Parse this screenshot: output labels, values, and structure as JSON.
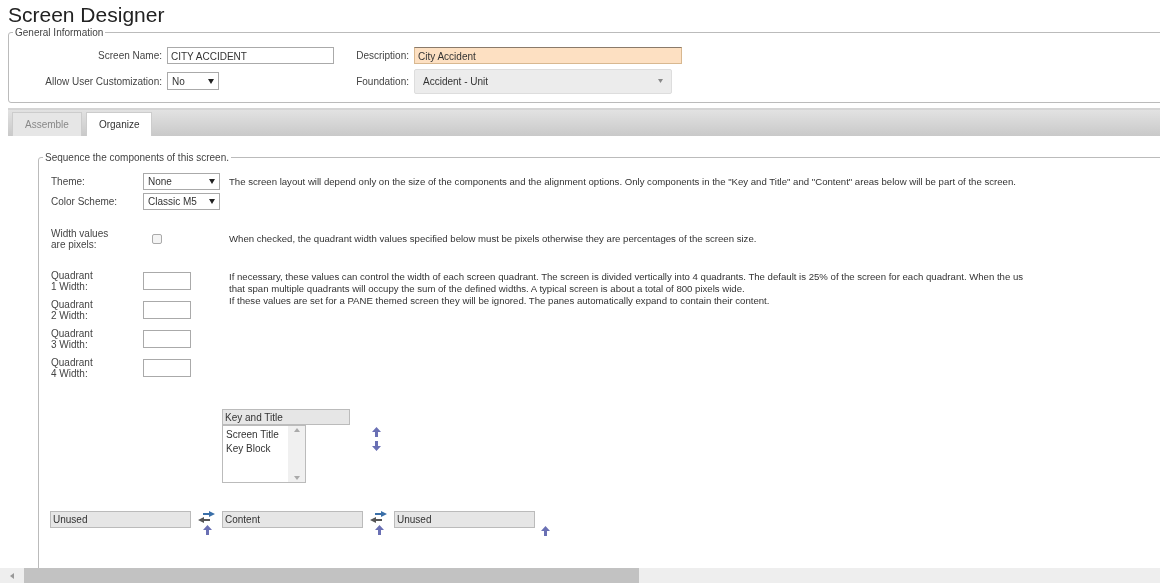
{
  "title": "Screen Designer",
  "general_information": {
    "legend": "General Information",
    "fields": [
      {
        "label": "Screen Name:",
        "kind": "text",
        "value": "CITY ACCIDENT",
        "highlighted": false
      },
      {
        "label": "Description:",
        "kind": "text",
        "value": "City Accident",
        "highlighted": true
      },
      {
        "label": "Allow User Customization:",
        "kind": "select",
        "value": "No"
      },
      {
        "label": "Foundation:",
        "kind": "combo",
        "value": "Accident - Unit"
      }
    ]
  },
  "tabs": [
    {
      "label": "Assemble",
      "selected": false
    },
    {
      "label": "Organize",
      "selected": true
    }
  ],
  "organize": {
    "legend": "Sequence the components of this screen.",
    "theme": {
      "label": "Theme:",
      "value": "None"
    },
    "color_scheme": {
      "label": "Color Scheme:",
      "value": "Classic M5"
    },
    "theme_note": "The screen layout will depend only on the size of the components and the alignment options. Only components in the \"Key and Title\" and \"Content\" areas below will be part of the screen.",
    "width_pixels": {
      "label": "Width values are pixels:",
      "checked": false,
      "note": "When checked, the quadrant width values specified below must be pixels otherwise they are percentages of the screen size."
    },
    "quadrants": [
      {
        "label": "Quadrant 1 Width:"
      },
      {
        "label": "Quadrant 2 Width:"
      },
      {
        "label": "Quadrant 3 Width:"
      },
      {
        "label": "Quadrant 4 Width:"
      }
    ],
    "quadrant_note": [
      "If necessary, these values can control the width of each screen quadrant. The screen is divided vertically into 4 quadrants. The default is 25% of the screen for each quadrant. When the us",
      "that span multiple quadrants will occupy the sum of the defined widths. A typical screen is about a total of 800 pixels wide.",
      "If these values are set for a PANE themed screen they will be ignored. The panes automatically expand to contain their content."
    ],
    "key_and_title": {
      "header": "Key and Title",
      "items": [
        "Screen Title",
        "Key Block"
      ]
    },
    "columns": [
      {
        "header": "Unused"
      },
      {
        "header": "Content"
      },
      {
        "header": "Unused"
      }
    ]
  }
}
